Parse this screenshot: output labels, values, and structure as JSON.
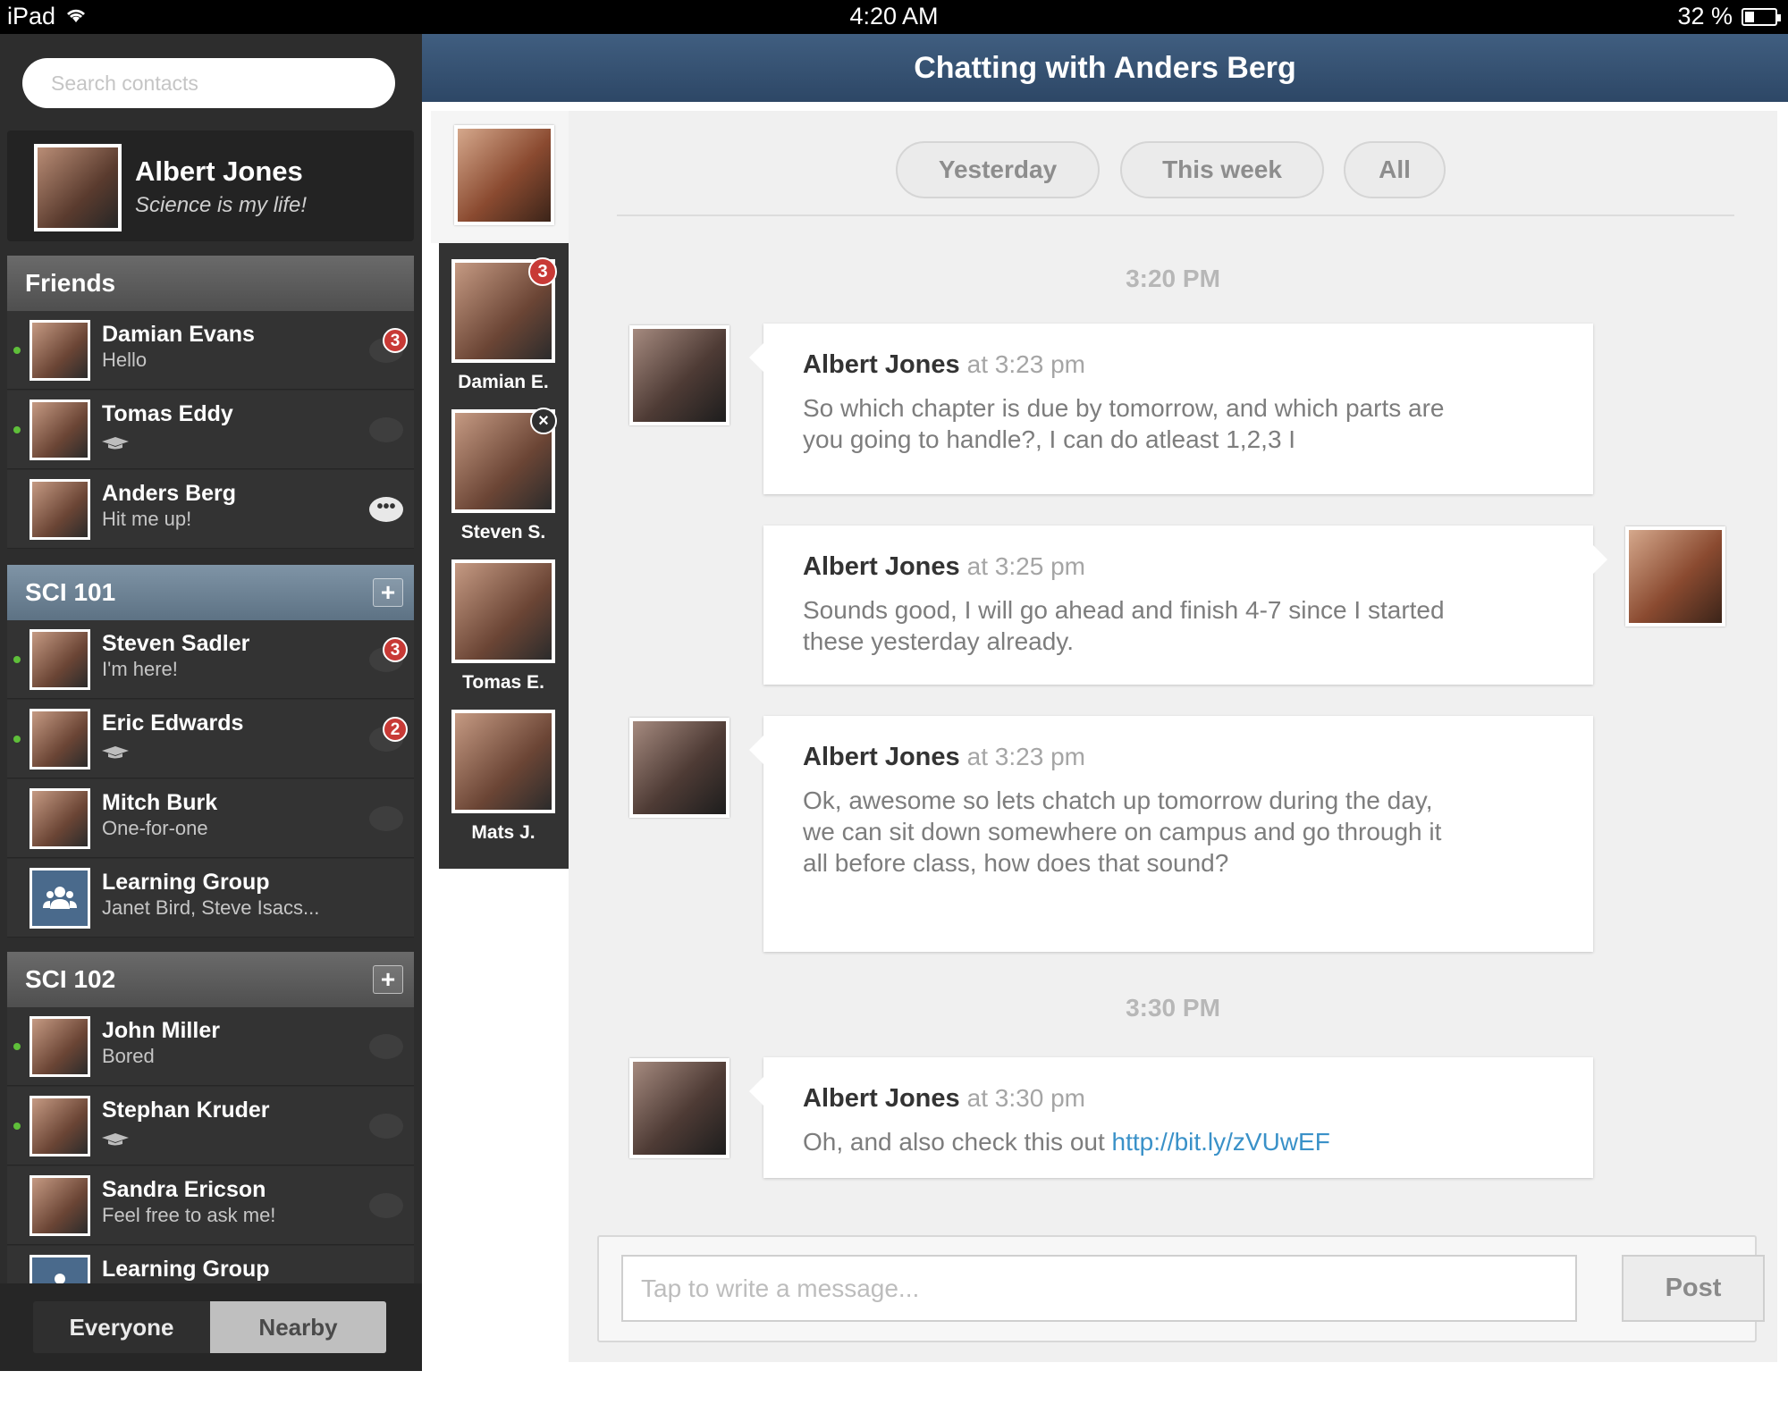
{
  "status_bar": {
    "device": "iPad",
    "time": "4:20 AM",
    "battery": "32 %",
    "battery_level": 0.32
  },
  "search": {
    "placeholder": "Search contacts"
  },
  "profile": {
    "name": "Albert Jones",
    "status": "Science is my life!"
  },
  "groups": [
    {
      "title": "Friends",
      "contacts": [
        {
          "name": "Damian Evans",
          "status": "Hello",
          "online": true,
          "unread": "3"
        },
        {
          "name": "Tomas Eddy",
          "status": "",
          "online": true,
          "unread": ""
        },
        {
          "name": "Anders Berg",
          "status": "Hit me up!",
          "online": false,
          "unread": "",
          "active": true
        }
      ]
    },
    {
      "title": "SCI 101",
      "contacts": [
        {
          "name": "Steven Sadler",
          "status": "I'm here!",
          "online": true,
          "unread": "3"
        },
        {
          "name": "Eric Edwards",
          "status": "",
          "online": true,
          "unread": "2"
        },
        {
          "name": "Mitch Burk",
          "status": "One-for-one",
          "online": false,
          "unread": ""
        },
        {
          "name": "Learning Group",
          "status": "Janet Bird, Steve Isacs...",
          "online": false,
          "unread": ""
        }
      ]
    },
    {
      "title": "SCI 102",
      "contacts": [
        {
          "name": "John Miller",
          "status": "Bored",
          "online": true,
          "unread": ""
        },
        {
          "name": "Stephan Kruder",
          "status": "",
          "online": true,
          "unread": ""
        },
        {
          "name": "Sandra Ericson",
          "status": "Feel free to ask me!",
          "online": false,
          "unread": ""
        },
        {
          "name": "Learning Group",
          "status": "",
          "online": false,
          "unread": ""
        }
      ]
    }
  ],
  "footer": {
    "everyone": "Everyone",
    "nearby": "Nearby"
  },
  "header": {
    "title": "Chatting with Anders Berg"
  },
  "participants": [
    {
      "label": "Damian E.",
      "badge": "3"
    },
    {
      "label": "Steven S.",
      "badge": "×"
    },
    {
      "label": "Tomas E.",
      "badge": ""
    },
    {
      "label": "Mats J.",
      "badge": ""
    }
  ],
  "filters": {
    "yesterday": "Yesterday",
    "this_week": "This week",
    "all": "All"
  },
  "timestamps": {
    "first": "3:20 PM",
    "second": "3:30 PM"
  },
  "messages": [
    {
      "author": "Albert Jones",
      "time": "at 3:23 pm",
      "text": "So which chapter is due by tomorrow, and which parts are you going to handle?, I can do atleast 1,2,3 I"
    },
    {
      "author": "Albert Jones",
      "time": "at 3:25 pm",
      "text": "Sounds good, I will go ahead and finish 4-7 since I started these yesterday already."
    },
    {
      "author": "Albert Jones",
      "time": "at 3:23 pm",
      "text": "Ok, awesome so lets chatch up tomorrow during the day, we can sit down somewhere on campus and go through it all before class, how does that sound?"
    },
    {
      "author": "Albert Jones",
      "time": "at 3:30 pm",
      "text": "Oh, and also check this out ",
      "link": "http://bit.ly/zVUwEF"
    }
  ],
  "composer": {
    "placeholder": "Tap to write a message...",
    "post_label": "Post"
  },
  "colors": {
    "header": "#354f70",
    "badge": "#c83a36",
    "online": "#5fbf3a",
    "link": "#3a91c8"
  }
}
